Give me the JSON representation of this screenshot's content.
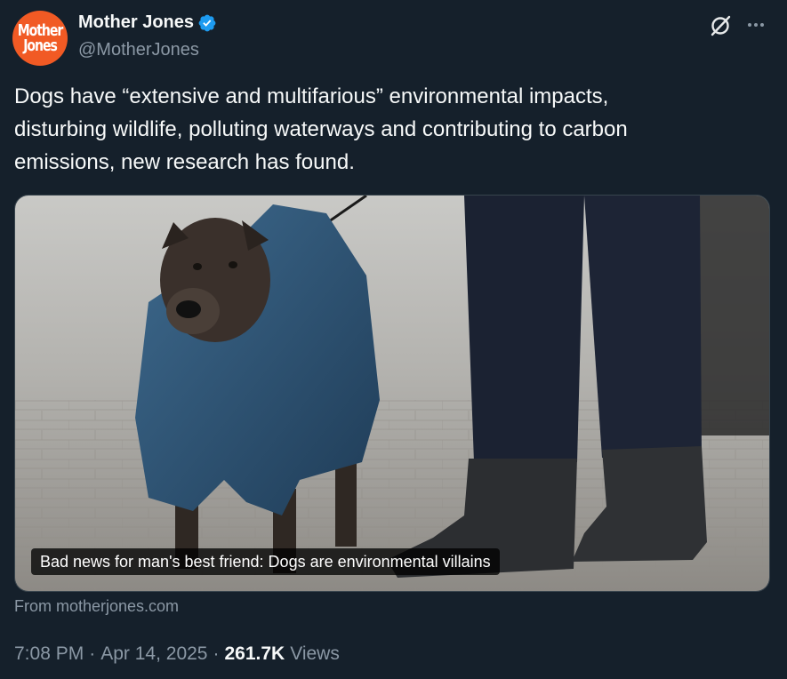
{
  "author": {
    "avatar_line1": "Mother",
    "avatar_line2": "Jones",
    "display_name": "Mother Jones",
    "handle": "@MotherJones",
    "verified": true
  },
  "tweet": {
    "text": "Dogs have “extensive and multifarious” environmental impacts,\ndisturbing wildlife, polluting waterways and contributing to carbon\nemissions, new research has found."
  },
  "card": {
    "caption": "Bad news for man's best friend: Dogs are environmental villains",
    "source": "From motherjones.com"
  },
  "meta": {
    "time": "7:08 PM",
    "separator": "·",
    "date": "Apr 14, 2025",
    "views_count": "261.7K",
    "views_label": "Views"
  },
  "icons": {
    "verified": "verified-badge-icon",
    "grok": "grok-icon",
    "more": "more-options-icon"
  },
  "colors": {
    "background": "#15202b",
    "text_primary": "#f7f9f9",
    "text_secondary": "#8b98a5",
    "verified_blue": "#1d9bf0",
    "avatar_orange": "#f15a24"
  }
}
